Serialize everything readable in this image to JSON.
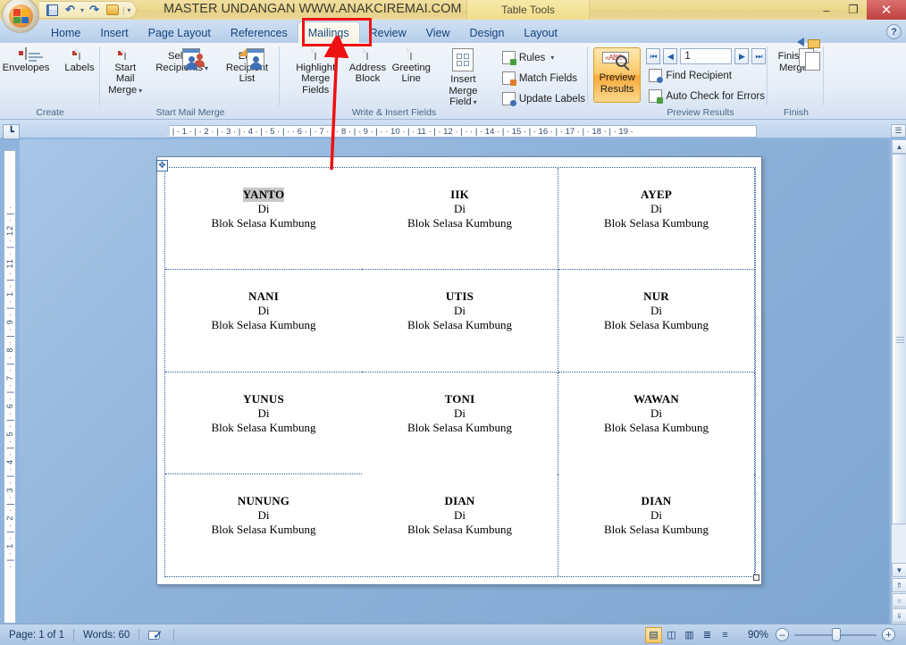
{
  "window": {
    "title": "MASTER UNDANGAN WWW.ANAKCIREMAI.COM ...",
    "contextual_tab": "Table Tools",
    "minimize": "–",
    "restore": "❐",
    "close": "✕"
  },
  "quick_access": {
    "save": "save-icon",
    "undo": "↶",
    "undo_caret": "▾",
    "redo": "↷",
    "open": "folder-icon",
    "customize": "▾"
  },
  "tabs": [
    {
      "label": "Home",
      "active": false
    },
    {
      "label": "Insert",
      "active": false
    },
    {
      "label": "Page Layout",
      "active": false
    },
    {
      "label": "References",
      "active": false
    },
    {
      "label": "Mailings",
      "active": true
    },
    {
      "label": "Review",
      "active": false
    },
    {
      "label": "View",
      "active": false
    },
    {
      "label": "Design",
      "active": false
    },
    {
      "label": "Layout",
      "active": false
    }
  ],
  "help": "?",
  "ribbon": {
    "groups": [
      {
        "name": "Create",
        "label": "Create",
        "buttons": [
          {
            "label": "Envelopes",
            "icon": "envelope-icon"
          },
          {
            "label": "Labels",
            "icon": "labels-icon"
          }
        ]
      },
      {
        "name": "Start Mail Merge",
        "label": "Start Mail Merge",
        "buttons": [
          {
            "label": "Start Mail",
            "label2": "Merge",
            "dropdown": true,
            "icon": "start-mail-merge-icon"
          },
          {
            "label": "Select",
            "label2": "Recipients",
            "dropdown": true,
            "icon": "select-recipients-icon"
          },
          {
            "label": "Edit",
            "label2": "Recipient List",
            "dropdown": false,
            "icon": "edit-recipient-list-icon"
          }
        ]
      },
      {
        "name": "Write & Insert Fields",
        "label": "Write & Insert Fields",
        "buttons": [
          {
            "label": "Highlight",
            "label2": "Merge Fields",
            "dropdown": false,
            "icon": "highlight-merge-fields-icon"
          },
          {
            "label": "Address",
            "label2": "Block",
            "dropdown": false,
            "icon": "address-block-icon"
          },
          {
            "label": "Greeting",
            "label2": "Line",
            "dropdown": false,
            "icon": "greeting-line-icon"
          },
          {
            "label": "Insert Merge",
            "label2": "Field",
            "dropdown": true,
            "icon": "insert-merge-field-icon"
          }
        ],
        "small_buttons": [
          {
            "label": "Rules",
            "dropdown": true,
            "icon": "rules-icon"
          },
          {
            "label": "Match Fields",
            "dropdown": false,
            "icon": "match-fields-icon"
          },
          {
            "label": "Update Labels",
            "dropdown": false,
            "icon": "update-labels-icon"
          }
        ]
      },
      {
        "name": "Preview Results",
        "label": "Preview Results",
        "preview_button": {
          "label": "Preview",
          "label2": "Results",
          "icon": "preview-results-icon",
          "active": true
        },
        "record_nav": {
          "first": "⏮",
          "prev": "◀",
          "value": "1",
          "next": "▶",
          "last": "⏭"
        },
        "small_buttons": [
          {
            "label": "Find Recipient",
            "icon": "find-recipient-icon"
          },
          {
            "label": "Auto Check for Errors",
            "icon": "auto-check-errors-icon"
          }
        ]
      },
      {
        "name": "Finish",
        "label": "Finish",
        "buttons": [
          {
            "label": "Finish &",
            "label2": "Merge",
            "dropdown": true,
            "icon": "finish-and-merge-icon"
          }
        ]
      }
    ]
  },
  "rulers": {
    "tab_selector": "┗",
    "horizontal": "· | · 1 · | · 2 · | · 3 · | · 4 · | · 5 · | · · 6 · | · 7 · | · 8 · | · 9 · | · · 10 · | · 11 · | · 12 · | · · | · 14 · | · 15 · | · 16 · | · 17 · | · 18 · | · 19 ·",
    "vertical": "· | · 1 · | · 2 · | · 3 · | · 4 · | · 5 · | · 6 · | · 7 · | · 8 · | · 9 · | · 1 · | · 11 · | · 12 · | ·"
  },
  "document": {
    "table_move_handle": "✥",
    "labels": [
      {
        "name": "YANTO",
        "di": "Di",
        "address": "Blok Selasa Kumbung",
        "selected": true
      },
      {
        "name": "IIK",
        "di": "Di",
        "address": "Blok Selasa Kumbung",
        "selected": false
      },
      {
        "name": "AYEP",
        "di": "Di",
        "address": "Blok Selasa Kumbung",
        "selected": false
      },
      {
        "name": "NANI",
        "di": "Di",
        "address": "Blok Selasa Kumbung",
        "selected": false
      },
      {
        "name": "UTIS",
        "di": "Di",
        "address": "Blok Selasa Kumbung",
        "selected": false
      },
      {
        "name": "NUR",
        "di": "Di",
        "address": "Blok Selasa Kumbung",
        "selected": false
      },
      {
        "name": "YUNUS",
        "di": "Di",
        "address": "Blok Selasa Kumbung",
        "selected": false
      },
      {
        "name": "TONI",
        "di": "Di",
        "address": "Blok Selasa Kumbung",
        "selected": false
      },
      {
        "name": "WAWAN",
        "di": "Di",
        "address": "Blok Selasa Kumbung",
        "selected": false
      },
      {
        "name": "NUNUNG",
        "di": "Di",
        "address": "Blok Selasa Kumbung",
        "selected": false
      },
      {
        "name": "DIAN",
        "di": "Di",
        "address": "Blok Selasa Kumbung",
        "selected": false
      },
      {
        "name": "DIAN",
        "di": "Di",
        "address": "Blok Selasa Kumbung",
        "selected": false
      }
    ]
  },
  "scrollbar": {
    "split": "☰",
    "up": "▲",
    "down": "▼",
    "prev_page": "⇑",
    "select_object": "○",
    "next_page": "⇓"
  },
  "statusbar": {
    "page": "Page: 1 of 1",
    "words": "Words: 60",
    "proofing": "proofing-errors-icon",
    "views": [
      {
        "name": "print-layout",
        "glyph": "▤",
        "active": true
      },
      {
        "name": "full-screen-reading",
        "glyph": "◫",
        "active": false
      },
      {
        "name": "web-layout",
        "glyph": "▥",
        "active": false
      },
      {
        "name": "outline",
        "glyph": "≣",
        "active": false
      },
      {
        "name": "draft",
        "glyph": "≡",
        "active": false
      }
    ],
    "zoom": "90%",
    "zoom_out": "–",
    "zoom_in": "+"
  },
  "annotations": {
    "highlight_target": "Mailings",
    "arrow_color": "#ee1111",
    "box_color": "#ee1111"
  }
}
